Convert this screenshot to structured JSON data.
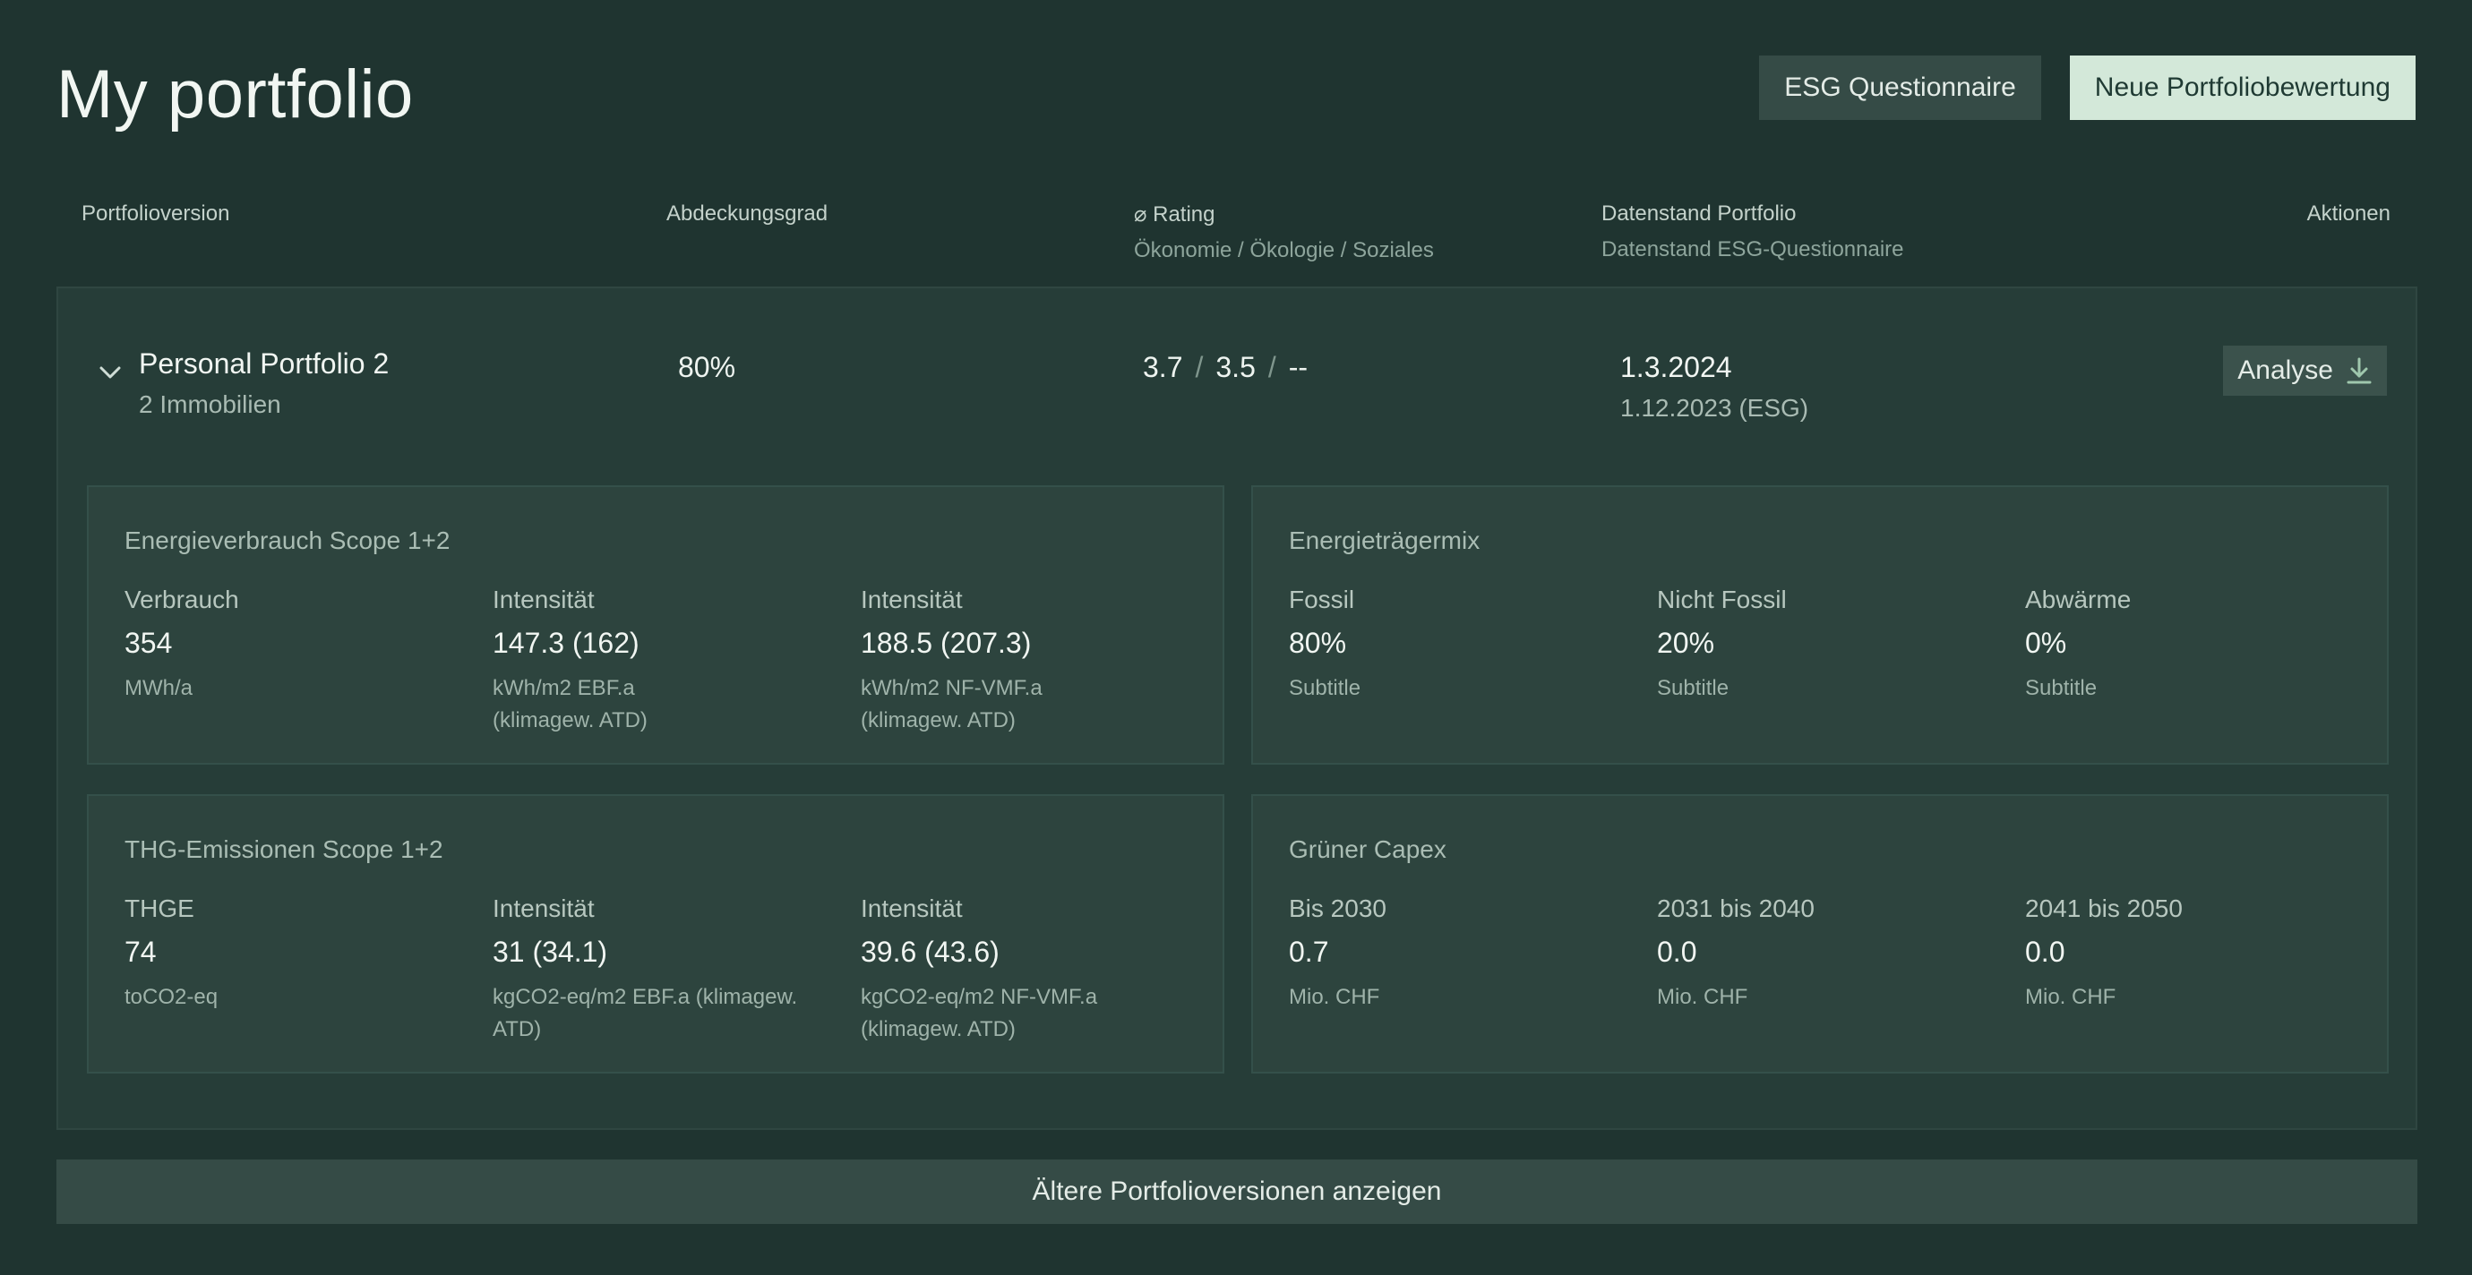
{
  "header": {
    "title": "My portfolio",
    "esg_button": "ESG Questionnaire",
    "new_button": "Neue Portfoliobewertung"
  },
  "columns": {
    "version": "Portfolioversion",
    "coverage": "Abdeckungsgrad",
    "rating": "⌀ Rating",
    "rating_sub": "Ökonomie / Ökologie / Soziales",
    "date": "Datenstand Portfolio",
    "date_sub": "Datenstand ESG-Questionnaire",
    "actions": "Aktionen"
  },
  "portfolio": {
    "name": "Personal Portfolio 2",
    "subtitle": "2 Immobilien",
    "coverage": "80%",
    "rating": {
      "oekonomie": "3.7",
      "oekologie": "3.5",
      "soziales": "--",
      "separator": "/"
    },
    "date_portfolio": "1.3.2024",
    "date_esg": "1.12.2023 (ESG)",
    "analyse_label": "Analyse"
  },
  "panels": {
    "energy": {
      "title": "Energieverbrauch Scope 1+2",
      "metrics": [
        {
          "label": "Verbrauch",
          "value": "354",
          "unit": "MWh/a"
        },
        {
          "label": "Intensität",
          "value": "147.3 (162)",
          "unit": "kWh/m2 EBF.a (klimagew. ATD)"
        },
        {
          "label": "Intensität",
          "value": "188.5 (207.3)",
          "unit": "kWh/m2 NF-VMF.a (klimagew. ATD)"
        }
      ]
    },
    "mix": {
      "title": "Energieträgermix",
      "metrics": [
        {
          "label": "Fossil",
          "value": "80%",
          "unit": "Subtitle"
        },
        {
          "label": "Nicht Fossil",
          "value": "20%",
          "unit": "Subtitle"
        },
        {
          "label": "Abwärme",
          "value": "0%",
          "unit": "Subtitle"
        }
      ]
    },
    "emissions": {
      "title": "THG-Emissionen Scope 1+2",
      "metrics": [
        {
          "label": "THGE",
          "value": "74",
          "unit": "toCO2-eq"
        },
        {
          "label": "Intensität",
          "value": "31 (34.1)",
          "unit": "kgCO2-eq/m2 EBF.a (klimagew. ATD)"
        },
        {
          "label": "Intensität",
          "value": "39.6 (43.6)",
          "unit": "kgCO2-eq/m2 NF-VMF.a (klimagew. ATD)"
        }
      ]
    },
    "capex": {
      "title": "Grüner Capex",
      "metrics": [
        {
          "label": "Bis 2030",
          "value": "0.7",
          "unit": "Mio. CHF"
        },
        {
          "label": "2031 bis 2040",
          "value": "0.0",
          "unit": "Mio. CHF"
        },
        {
          "label": "2041 bis 2050",
          "value": "0.0",
          "unit": "Mio. CHF"
        }
      ]
    }
  },
  "footer": {
    "older_versions": "Ältere Portfolioversionen anzeigen"
  },
  "colors": {
    "background": "#1f3430",
    "card": "#263d38",
    "panel": "#2d443e",
    "primary_button": "#d3e8d9"
  },
  "icons": {
    "expand": "chevron-down-icon",
    "download": "download-icon"
  }
}
